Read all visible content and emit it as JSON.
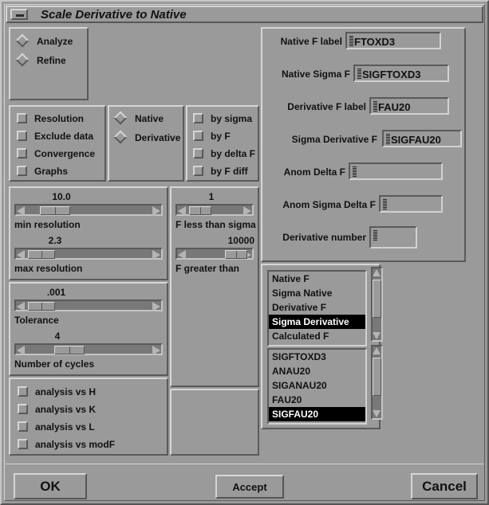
{
  "window": {
    "title": "Scale Derivative to Native",
    "minimize_icon": "minimize-icon"
  },
  "mode_panel": {
    "options": [
      {
        "label": "Analyze",
        "selected": false
      },
      {
        "label": "Refine",
        "selected": false
      }
    ]
  },
  "output_panel": {
    "options": [
      {
        "label": "Resolution",
        "checked": false
      },
      {
        "label": "Exclude data",
        "checked": false
      },
      {
        "label": "Convergence",
        "checked": false
      },
      {
        "label": "Graphs",
        "checked": false
      }
    ]
  },
  "reference_panel": {
    "options": [
      {
        "label": "Native",
        "selected": false
      },
      {
        "label": "Derivative",
        "selected": false
      }
    ]
  },
  "weight_panel": {
    "options": [
      {
        "label": "by sigma",
        "checked": false
      },
      {
        "label": "by F",
        "checked": false
      },
      {
        "label": "by delta F",
        "checked": false
      },
      {
        "label": "by F diff",
        "checked": false
      }
    ]
  },
  "resolution_sliders": [
    {
      "value": "10.0",
      "label": "min resolution",
      "fill": 0.17
    },
    {
      "value": "2.3",
      "label": "max resolution",
      "fill": 0.08
    }
  ],
  "tolerance_sliders": [
    {
      "value": ".001",
      "label": "Tolerance",
      "fill": 0.08
    },
    {
      "value": "4",
      "label": "Number of cycles",
      "fill": 0.3
    }
  ],
  "f_sliders": [
    {
      "value": "1",
      "label": "F less than sigma",
      "fill": 0.12
    },
    {
      "value": "10000",
      "label": "F greater than",
      "fill": 0.78
    }
  ],
  "analysis_panel": {
    "options": [
      {
        "label": "analysis vs H",
        "checked": false
      },
      {
        "label": "analysis vs K",
        "checked": false
      },
      {
        "label": "analysis vs L",
        "checked": false
      },
      {
        "label": "analysis vs modF",
        "checked": false
      }
    ]
  },
  "labels_panel": {
    "fields": [
      {
        "label": "Native F label",
        "value": "FTOXD3"
      },
      {
        "label": "Native Sigma F",
        "value": "SIGFTOXD3"
      },
      {
        "label": "Derivative F label",
        "value": "FAU20"
      },
      {
        "label": "Sigma Derivative F",
        "value": "SIGFAU20"
      },
      {
        "label": "Anom Delta F",
        "value": ""
      },
      {
        "label": "Anom Sigma Delta F",
        "value": ""
      },
      {
        "label": "Derivative number",
        "value": ""
      }
    ]
  },
  "column_type_list": {
    "items": [
      {
        "label": "Native F",
        "selected": false
      },
      {
        "label": "Sigma Native",
        "selected": false
      },
      {
        "label": "Derivative F",
        "selected": false
      },
      {
        "label": "Sigma Derivative",
        "selected": true
      },
      {
        "label": "Calculated F",
        "selected": false
      }
    ]
  },
  "column_name_list": {
    "items": [
      {
        "label": "SIGFTOXD3",
        "selected": false
      },
      {
        "label": "ANAU20",
        "selected": false
      },
      {
        "label": "SIGANAU20",
        "selected": false
      },
      {
        "label": "FAU20",
        "selected": false
      },
      {
        "label": "SIGFAU20",
        "selected": true
      }
    ]
  },
  "buttons": {
    "ok": "OK",
    "accept": "Accept",
    "cancel": "Cancel"
  },
  "colors": {
    "background": "#9a9a9a",
    "shadow_light": "#d6d6d6",
    "shadow_dark": "#5a5a5a",
    "trough": "#787878",
    "selection_bg": "#000000",
    "selection_fg": "#ffffff",
    "text": "#111111"
  }
}
